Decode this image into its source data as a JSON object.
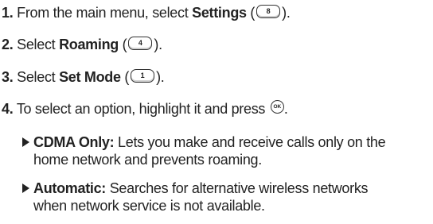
{
  "steps": [
    {
      "num": "1.",
      "before": "From the main menu, select ",
      "bold": "Settings",
      "open": " (",
      "key": "8",
      "close": ")."
    },
    {
      "num": "2.",
      "before": "Select ",
      "bold": "Roaming",
      "open": " (",
      "key": "4",
      "close": ")."
    },
    {
      "num": "3.",
      "before": "Select ",
      "bold": "Set Mode",
      "open": " (",
      "key": "1",
      "close": ")."
    },
    {
      "num": "4.",
      "text": "To select an option, highlight it and press ",
      "key": "OK",
      "end": "."
    }
  ],
  "options": [
    {
      "term": "CDMA Only:",
      "line1": " Lets you make and receive calls only on the",
      "line2": "home network and prevents roaming."
    },
    {
      "term": "Automatic:",
      "line1": " Searches for alternative wireless networks",
      "line2": "when network service is not available."
    }
  ]
}
